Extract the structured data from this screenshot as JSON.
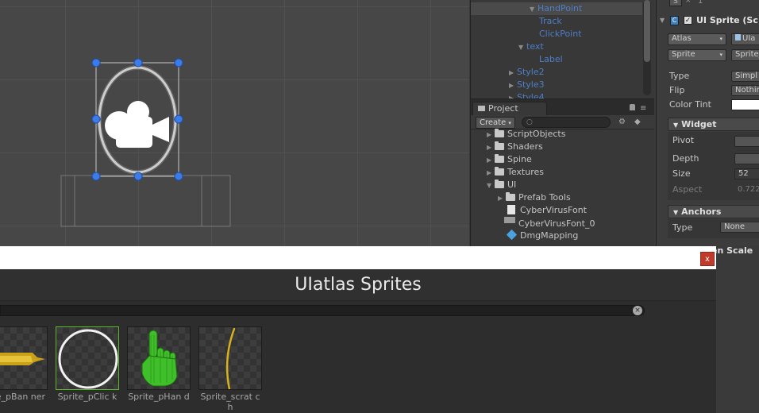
{
  "hierarchy": {
    "items": [
      {
        "label": "HandPoint",
        "expanded": true,
        "selected": true
      },
      {
        "label": "Track"
      },
      {
        "label": "ClickPoint"
      },
      {
        "label": "text",
        "expanded": true
      },
      {
        "label": "Label"
      },
      {
        "label": "Style2",
        "collapsed": true
      },
      {
        "label": "Style3",
        "collapsed": true
      },
      {
        "label": "Style4",
        "collapsed": true
      }
    ]
  },
  "project": {
    "tab": "Project",
    "create_label": "Create",
    "items": [
      {
        "label": "ScriptObjects",
        "icon": "folder-icon"
      },
      {
        "label": "Shaders",
        "icon": "folder-icon"
      },
      {
        "label": "Spine",
        "icon": "folder-icon"
      },
      {
        "label": "Textures",
        "icon": "folder-icon"
      },
      {
        "label": "UI",
        "icon": "folder-icon"
      },
      {
        "label": "Prefab Tools",
        "icon": "folder-icon"
      },
      {
        "label": "CyberVirusFont",
        "icon": "file-icon"
      },
      {
        "label": "CyberVirusFont_0",
        "icon": "texture-icon"
      },
      {
        "label": "DmgMapping",
        "icon": "prefab-icon"
      }
    ]
  },
  "inspector": {
    "top_search": "1",
    "component_title": "UI Sprite (Sc",
    "atlas_label": "Atlas",
    "atlas_value": "UIa",
    "sprite_label": "Sprite",
    "sprite_value": "Sprite_",
    "type_label": "Type",
    "type_value": "Simpl",
    "flip_label": "Flip",
    "flip_value": "Nothin",
    "color_tint_label": "Color Tint",
    "widget_header": "Widget",
    "pivot_label": "Pivot",
    "depth_label": "Depth",
    "size_label": "Size",
    "size_value": "52",
    "aspect_label": "Aspect",
    "aspect_value": "0.722",
    "anchors_header": "Anchors",
    "anchor_type_label": "Type",
    "anchor_type_value": "None",
    "screen_scale": "en Scale"
  },
  "picker": {
    "close_label": "x",
    "title": "UIatlas Sprites",
    "sprites": [
      {
        "label": "Sprite_pBanner",
        "label_display": "rite_pBan ner"
      },
      {
        "label": "Sprite_pClick",
        "label_display": "Sprite_pClic k",
        "selected": true
      },
      {
        "label": "Sprite_pHand",
        "label_display": "Sprite_pHan d"
      },
      {
        "label": "Sprite_scratch",
        "label_display": "Sprite_scrat ch"
      }
    ]
  },
  "colors": {
    "hierarchy_text": "#4f7fc4",
    "selection_outline": "#5ab82a",
    "close_button": "#c0392b",
    "handle_blue": "#3d7be8"
  }
}
